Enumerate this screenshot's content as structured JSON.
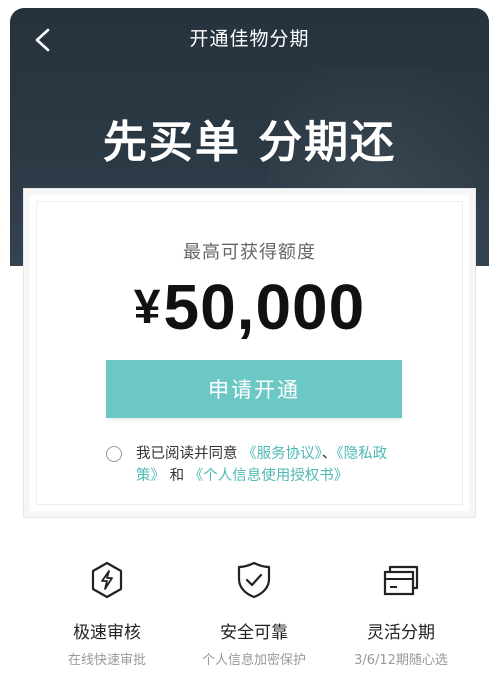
{
  "header": {
    "back_icon": "chevron-left-icon",
    "title": "开通佳物分期",
    "headline": "先买单 分期还",
    "background_color": "#2b3945"
  },
  "card": {
    "quota_label": "最高可获得额度",
    "currency_symbol": "¥",
    "amount": "50,000",
    "apply_button_label": "申请开通",
    "button_color": "#6cc8c5",
    "agreement": {
      "checked": false,
      "prefix": "我已阅读并同意",
      "service_agreement": "《服务协议》",
      "separator": "、",
      "privacy_policy": "《隐私政策》",
      "and": "和",
      "personal_info_auth": "《个人信息使用授权书》",
      "link_color": "#4fb9b4"
    }
  },
  "features": [
    {
      "icon": "lightning-shield-icon",
      "title": "极速审核",
      "subtitle": "在线快速审批"
    },
    {
      "icon": "check-shield-icon",
      "title": "安全可靠",
      "subtitle": "个人信息加密保护"
    },
    {
      "icon": "card-stack-icon",
      "title": "灵活分期",
      "subtitle": "3/6/12期随心选"
    }
  ]
}
